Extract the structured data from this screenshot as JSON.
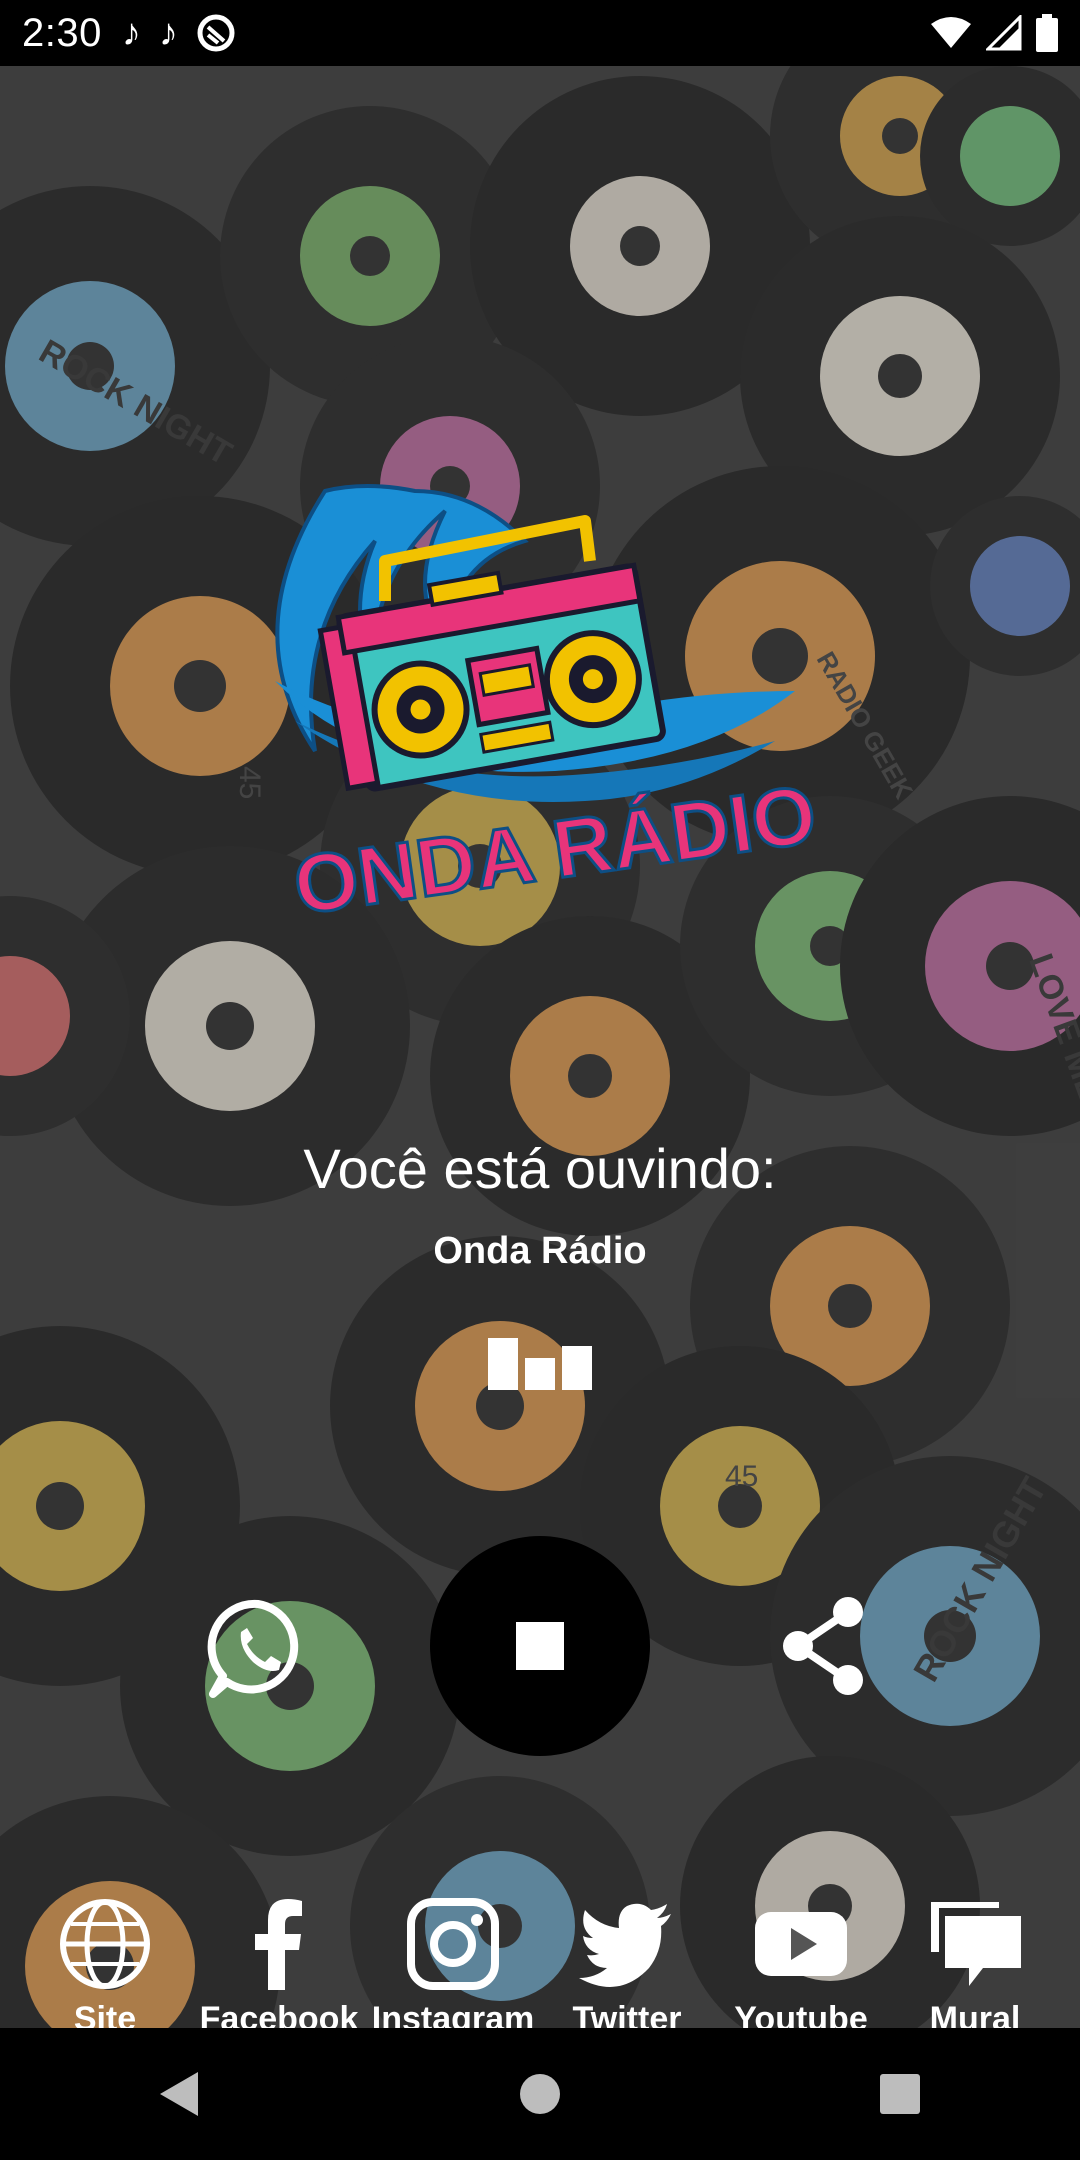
{
  "status_bar": {
    "time": "2:30",
    "icons": [
      "music-note-icon",
      "music-note-icon",
      "sync-icon",
      "wifi-icon",
      "cell-signal-icon",
      "battery-icon"
    ]
  },
  "background": {
    "record_labels": [
      "ROCK NIGHT",
      "RADIO GEEK",
      "45",
      "LOVE ME",
      "ROCK NIGHT",
      "45"
    ]
  },
  "logo": {
    "text": "ONDA RÁDIO"
  },
  "player": {
    "listening_label": "Você está ouvindo:",
    "station_name": "Onda Rádio",
    "state": "playing"
  },
  "social": [
    {
      "label": "Site",
      "icon": "globe-icon"
    },
    {
      "label": "Facebook",
      "icon": "facebook-icon"
    },
    {
      "label": "Instagram",
      "icon": "instagram-icon"
    },
    {
      "label": "Twitter",
      "icon": "twitter-icon"
    },
    {
      "label": "Youtube",
      "icon": "youtube-icon"
    },
    {
      "label": "Mural",
      "icon": "chat-icon"
    }
  ],
  "colors": {
    "logo_pink": "#e8347a",
    "logo_blue": "#1a8fd6",
    "logo_yellow": "#f2c200",
    "boombox_teal": "#3ec5c0"
  }
}
